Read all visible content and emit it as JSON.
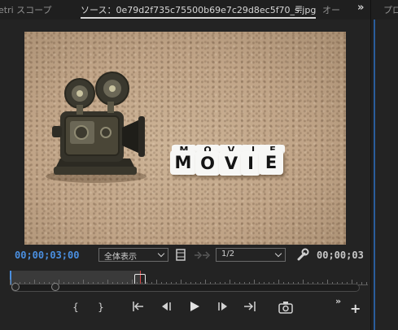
{
  "tabs": {
    "lumetri": "etri スコープ",
    "source": "ソース：0e79d2f735c75500b69e7c29d8ec5f70_s.jpg",
    "menu_glyph": "≡",
    "audio": "オー",
    "overflow": "»",
    "program": "プロ"
  },
  "monitor": {
    "current_timecode": "00;00;03;00",
    "duration_timecode": "00;00;03",
    "fit_select": "全体表示",
    "resolution_select": "1/2",
    "image_letters_top": [
      "M",
      "O",
      "V",
      "I",
      "E"
    ],
    "image_letters_bottom": [
      "M",
      "O",
      "V",
      "I",
      "E"
    ]
  },
  "transport": {
    "mark_in": "{",
    "mark_out": "}",
    "go_to_in": "{←",
    "step_back": "◀I",
    "play": "▶",
    "step_forward": "I▶",
    "go_to_out": "→}",
    "export_frame_icon": "camera-icon",
    "more": "»",
    "add": "+"
  },
  "colors": {
    "accent_blue": "#4a8fe0",
    "playhead_red": "#d94a4a"
  }
}
